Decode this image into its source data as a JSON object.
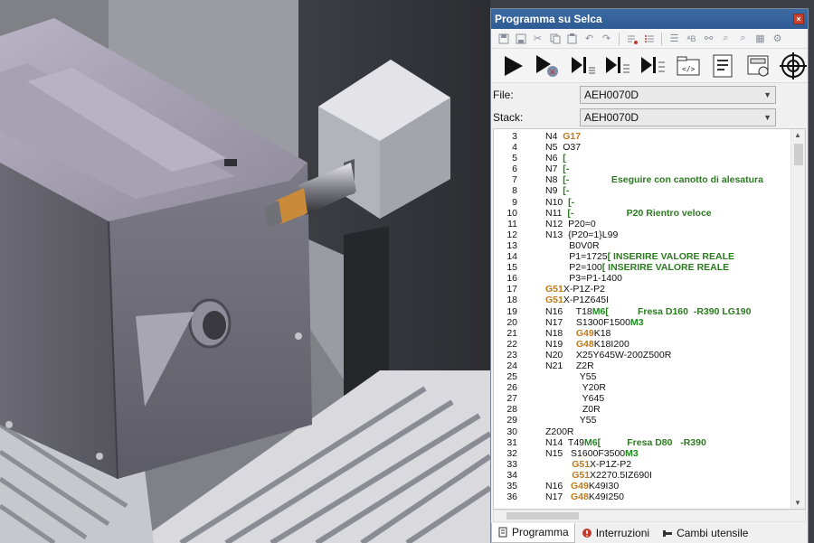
{
  "window": {
    "title": "Programma su Selca",
    "close_glyph": "×"
  },
  "toolbar_small": [
    "save-icon",
    "save-as-icon",
    "cut-icon",
    "copy-icon",
    "paste-icon",
    "undo-icon",
    "redo-icon",
    "list-delete-icon",
    "list-icon",
    "indent-icon",
    "replace-icon",
    "find-icon",
    "find-next-icon",
    "find-prev-icon",
    "grid-icon",
    "settings-icon"
  ],
  "toolbar_big": [
    "play-icon",
    "stop-reset-icon",
    "step-in-icon",
    "step-over-icon",
    "step-out-icon",
    "open-folder-icon",
    "document-icon",
    "calculator-icon",
    "target-icon"
  ],
  "file": {
    "label": "File:",
    "value": "AEH0070D"
  },
  "stack": {
    "label": "Stack:",
    "value": "AEH0070D"
  },
  "code": [
    {
      "n": "3",
      "segs": [
        [
          "t",
          "N4  "
        ],
        [
          "g",
          "G17"
        ]
      ]
    },
    {
      "n": "4",
      "segs": [
        [
          "t",
          "N5  O37"
        ]
      ]
    },
    {
      "n": "5",
      "segs": [
        [
          "t",
          "N6  "
        ],
        [
          "c",
          "["
        ]
      ]
    },
    {
      "n": "6",
      "segs": [
        [
          "t",
          "N7  "
        ],
        [
          "c",
          "[-"
        ]
      ]
    },
    {
      "n": "7",
      "segs": [
        [
          "t",
          "N8  "
        ],
        [
          "c",
          "[-                Eseguire con canotto di alesatura"
        ]
      ]
    },
    {
      "n": "8",
      "segs": [
        [
          "t",
          "N9  "
        ],
        [
          "c",
          "[-"
        ]
      ]
    },
    {
      "n": "9",
      "segs": [
        [
          "t",
          "N10  "
        ],
        [
          "c",
          "[-"
        ]
      ]
    },
    {
      "n": "10",
      "segs": [
        [
          "t",
          "N11  "
        ],
        [
          "c",
          "[-                    P20 Rientro veloce"
        ]
      ]
    },
    {
      "n": "11",
      "segs": [
        [
          "t",
          "N12  P20=0"
        ]
      ]
    },
    {
      "n": "12",
      "segs": [
        [
          "t",
          "N13  {P20=1}L99"
        ]
      ]
    },
    {
      "n": "13",
      "segs": [
        [
          "t",
          "         B0V0R"
        ]
      ]
    },
    {
      "n": "14",
      "segs": [
        [
          "t",
          "         P1=1725"
        ],
        [
          "c",
          "[ INSERIRE VALORE REALE"
        ]
      ]
    },
    {
      "n": "15",
      "segs": [
        [
          "t",
          "         P2=100"
        ],
        [
          "c",
          "[ INSERIRE VALORE REALE"
        ]
      ]
    },
    {
      "n": "16",
      "segs": [
        [
          "t",
          "         P3=P1-1400"
        ]
      ]
    },
    {
      "n": "17",
      "segs": [
        [
          "g",
          "G51"
        ],
        [
          "t",
          "X-P1Z-P2"
        ]
      ]
    },
    {
      "n": "18",
      "segs": [
        [
          "g",
          "G51"
        ],
        [
          "t",
          "X-P1Z645I"
        ]
      ]
    },
    {
      "n": "19",
      "segs": [
        [
          "t",
          "N16     T18"
        ],
        [
          "m",
          "M6"
        ],
        [
          "c",
          "[           Fresa D160  -R390 LG190"
        ]
      ]
    },
    {
      "n": "20",
      "segs": [
        [
          "t",
          "N17     S1300F1500"
        ],
        [
          "m",
          "M3"
        ]
      ]
    },
    {
      "n": "21",
      "segs": [
        [
          "t",
          "N18     "
        ],
        [
          "g",
          "G49"
        ],
        [
          "t",
          "K18"
        ]
      ]
    },
    {
      "n": "22",
      "segs": [
        [
          "t",
          "N19     "
        ],
        [
          "g",
          "G48"
        ],
        [
          "t",
          "K18I200"
        ]
      ]
    },
    {
      "n": "23",
      "segs": [
        [
          "t",
          "N20     X25Y645W-200Z500R"
        ]
      ]
    },
    {
      "n": "24",
      "segs": [
        [
          "t",
          "N21     Z2R"
        ]
      ]
    },
    {
      "n": "25",
      "segs": [
        [
          "t",
          "             Y55"
        ]
      ]
    },
    {
      "n": "26",
      "segs": [
        [
          "t",
          "              Y20R"
        ]
      ]
    },
    {
      "n": "27",
      "segs": [
        [
          "t",
          "              Y645"
        ]
      ]
    },
    {
      "n": "28",
      "segs": [
        [
          "t",
          "              Z0R"
        ]
      ]
    },
    {
      "n": "29",
      "segs": [
        [
          "t",
          "             Y55"
        ]
      ]
    },
    {
      "n": "30",
      "segs": [
        [
          "t",
          "Z200R"
        ]
      ]
    },
    {
      "n": "31",
      "segs": [
        [
          "t",
          "N14  T49"
        ],
        [
          "m",
          "M6"
        ],
        [
          "c",
          "[          Fresa D80   -R390"
        ]
      ]
    },
    {
      "n": "32",
      "segs": [
        [
          "t",
          "N15   S1600F3500"
        ],
        [
          "m",
          "M3"
        ]
      ]
    },
    {
      "n": "33",
      "segs": [
        [
          "t",
          "          "
        ],
        [
          "g",
          "G51"
        ],
        [
          "t",
          "X-P1Z-P2"
        ]
      ]
    },
    {
      "n": "34",
      "segs": [
        [
          "t",
          "          "
        ],
        [
          "g",
          "G51"
        ],
        [
          "t",
          "X2270.5IZ690I"
        ]
      ]
    },
    {
      "n": "35",
      "segs": [
        [
          "t",
          "N16   "
        ],
        [
          "g",
          "G49"
        ],
        [
          "t",
          "K49I30"
        ]
      ]
    },
    {
      "n": "36",
      "segs": [
        [
          "t",
          "N17   "
        ],
        [
          "g",
          "G48"
        ],
        [
          "t",
          "K49I250"
        ]
      ]
    }
  ],
  "tabs": [
    {
      "label": "Programma",
      "icon": "document-icon",
      "active": true
    },
    {
      "label": "Interruzioni",
      "icon": "warning-icon",
      "active": false
    },
    {
      "label": "Cambi utensile",
      "icon": "tool-icon",
      "active": false
    }
  ]
}
